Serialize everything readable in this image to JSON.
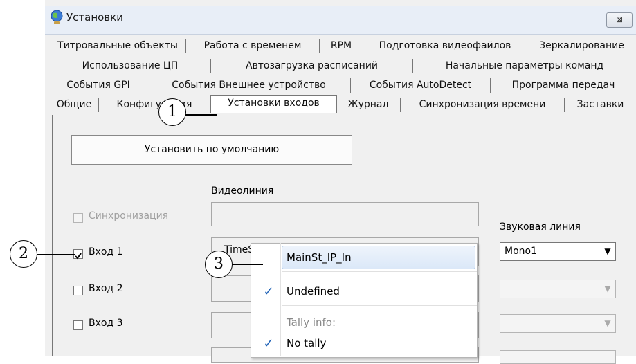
{
  "window": {
    "title": "Установки",
    "close_label": "⊠"
  },
  "tabs": {
    "row1": [
      "Титровальные объекты",
      "Работа с временем",
      "RPM",
      "Подготовка видеофайлов",
      "Зеркалирование"
    ],
    "row2": [
      "Использование ЦП",
      "Автозагрузка расписаний",
      "Начальные параметры команд"
    ],
    "row3": [
      "События GPI",
      "События Внешнее устройство",
      "События AutoDetect",
      "Программа передач"
    ],
    "row4": [
      "Общие",
      "Конфигурация",
      "Установки входов",
      "Журнал",
      "Синхронизация времени",
      "Заставки"
    ],
    "active": "Установки входов"
  },
  "main": {
    "default_button": "Установить по умолчанию",
    "video_line_label": "Видеолиния",
    "audio_line_label": "Звуковая линия",
    "sync_label": "Синхронизация",
    "inputs": [
      {
        "label": "Вход 1",
        "checked": true,
        "video_value": "TimeS",
        "audio_value": "Mono1"
      },
      {
        "label": "Вход 2",
        "checked": false,
        "video_value": "",
        "audio_value": ""
      },
      {
        "label": "Вход 3",
        "checked": false,
        "video_value": "",
        "audio_value": ""
      }
    ]
  },
  "context_menu": {
    "items": [
      {
        "label": "MainSt_IP_In",
        "checked": false,
        "highlighted": true
      },
      {
        "label": "Undefined",
        "checked": true
      },
      {
        "label": "Tally info:",
        "checked": false,
        "header": true
      },
      {
        "label": "No tally",
        "checked": true
      }
    ]
  },
  "callouts": [
    "1",
    "2",
    "3"
  ]
}
